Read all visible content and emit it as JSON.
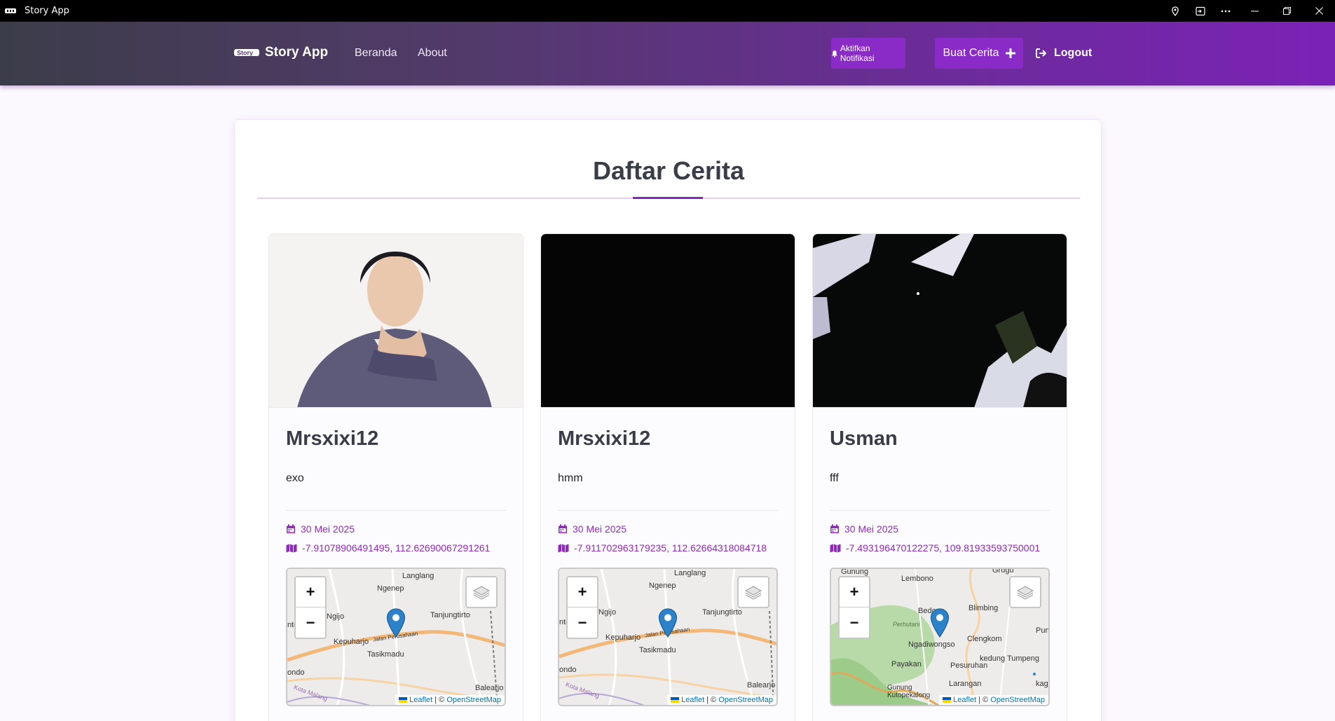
{
  "window": {
    "title": "Story App"
  },
  "header": {
    "brand": "Story App",
    "nav": [
      "Beranda",
      "About"
    ],
    "notify_label": "Aktifkan Notifikasi",
    "create_label": "Buat Cerita",
    "logout_label": "Logout"
  },
  "main": {
    "title": "Daftar Cerita",
    "stories": [
      {
        "name": "Mrsxixi12",
        "description": "exo",
        "date": "30 Mei 2025",
        "coords": "-7.91078906491495, 112.62690067291261",
        "image": "portrait-photo",
        "map_labels": [
          "Langlang",
          "Ngenep",
          "Ngijo",
          "Tanjungtirto",
          "Kepuharjo",
          "Jalan Perusahaan",
          "Tasikmadu",
          "ondo",
          "Balearjo",
          "Kota Malang",
          "nto"
        ]
      },
      {
        "name": "Mrsxixi12",
        "description": "hmm",
        "date": "30 Mei 2025",
        "coords": "-7.911702963179235, 112.62664318084718",
        "image": "dark-photo",
        "map_labels": [
          "Langlang",
          "Ngenep",
          "Ngijo",
          "Tanjungtirto",
          "Kepuharjo",
          "Jalan Perusahaan",
          "Tasikmadu",
          "ondo",
          "Balearjo",
          "Kota Malang",
          "nto"
        ]
      },
      {
        "name": "Usman",
        "description": "fff",
        "date": "30 Mei 2025",
        "coords": "-7.493196470122275, 109.81933593750001",
        "image": "shadow-photo",
        "map_labels": [
          "Gunung",
          "Lembono",
          "Grugu",
          "Bedono",
          "Blimbing",
          "Perhutani",
          "Clengkom",
          "Ngadiwongso",
          "Pund",
          "kedung Tumpeng",
          "Payakan",
          "Pesuruhan",
          "Gunung Kutopekalong",
          "Larangan",
          "kag"
        ]
      }
    ],
    "map_zoom_in": "+",
    "map_zoom_out": "−",
    "map_attribution_leaflet": "Leaflet",
    "map_attribution_sep": "| ©",
    "map_attribution_osm": "OpenStreetMap"
  },
  "colors": {
    "accent": "#8a2bc7",
    "meta_text": "#8e2bb7",
    "title_text": "#3a3d48"
  }
}
